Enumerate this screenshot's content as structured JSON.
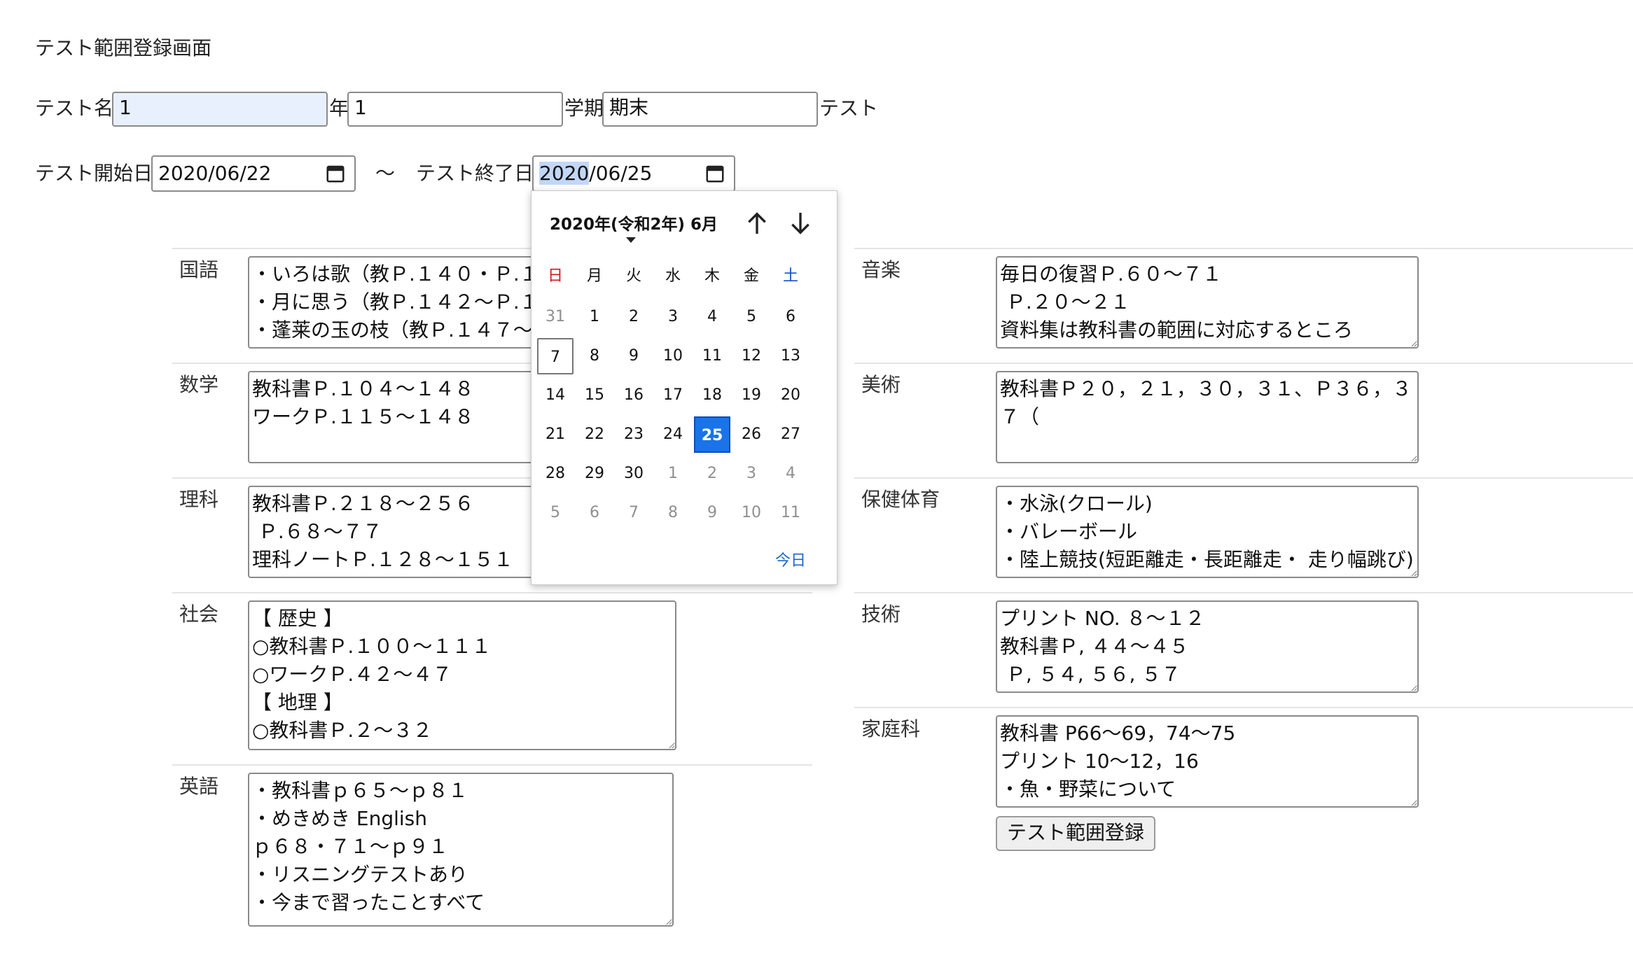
{
  "page_title": "テスト範囲登録画面",
  "row1": {
    "label_test_name": "テスト名",
    "grade_value": "1",
    "label_year": "年",
    "term_value": "1",
    "label_term": "学期",
    "kind_value": "期末",
    "label_test": "テスト"
  },
  "row2": {
    "label_start": "テスト開始日",
    "start_date": "2020/06/22",
    "tilde": "〜",
    "label_end": "テスト終了日",
    "end_date_year": "2020",
    "end_date_rest": "/06/25"
  },
  "calendar": {
    "title": "2020年(令和2年) 6月",
    "weekdays": [
      "日",
      "月",
      "火",
      "水",
      "木",
      "金",
      "土"
    ],
    "weeks": [
      [
        "31",
        "1",
        "2",
        "3",
        "4",
        "5",
        "6"
      ],
      [
        "7",
        "8",
        "9",
        "10",
        "11",
        "12",
        "13"
      ],
      [
        "14",
        "15",
        "16",
        "17",
        "18",
        "19",
        "20"
      ],
      [
        "21",
        "22",
        "23",
        "24",
        "25",
        "26",
        "27"
      ],
      [
        "28",
        "29",
        "30",
        "1",
        "2",
        "3",
        "4"
      ],
      [
        "5",
        "6",
        "7",
        "8",
        "9",
        "10",
        "11"
      ]
    ],
    "selected_day": "25",
    "today_day": "7",
    "today_label": "今日"
  },
  "subjects": {
    "kokugo": {
      "label": "国語",
      "value": "・いろは歌（教Ｐ.１４０・Ｐ.１４\n・月に思う（教Ｐ.１４２〜Ｐ.１４\n・蓬莱の玉の枝（教Ｐ.１４７〜Ｐ"
    },
    "sugaku": {
      "label": "数学",
      "value": "教科書Ｐ.１０４〜１４８\nワークＰ.１１５〜１４８"
    },
    "rika": {
      "label": "理科",
      "value": "教科書Ｐ.２１８〜２５６\n Ｐ.６８〜７７\n理科ノートＰ.１２８〜１５１"
    },
    "shakai": {
      "label": "社会",
      "value": "【 歴史 】\n○教科書Ｐ.１００〜１１１\n○ワークＰ.４２〜４７\n【 地理 】\n○教科書Ｐ.２〜３２"
    },
    "eigo": {
      "label": "英語",
      "value": "・教科書ｐ６５〜ｐ８１\n・めきめき English\nｐ６８・７１〜ｐ９１\n・リスニングテストあり\n・今まで習ったことすべて"
    },
    "ongaku": {
      "label": "音楽",
      "value": "毎日の復習Ｐ.６０〜７１\n Ｐ.２０〜２１\n資料集は教科書の範囲に対応するところ"
    },
    "bijutsu": {
      "label": "美術",
      "value": "教科書Ｐ２０，２１，３０，３１、Ｐ３６，３\n７（"
    },
    "hoken": {
      "label": "保健体育",
      "value": "・水泳(クロール)\n・バレーボール\n・陸上競技(短距離走・長距離走・ 走り幅跳び)"
    },
    "gijutsu": {
      "label": "技術",
      "value": "プリント NO. ８〜１２\n教科書Ｐ, ４４〜４５\n Ｐ, ５４, ５６, ５７"
    },
    "katei": {
      "label": "家庭科",
      "value": "教科書 P66〜69，74〜75\nプリント 10〜12，16\n・魚・野菜について"
    }
  },
  "submit_label": "テスト範囲登録",
  "colors": {
    "selected_day_bg": "#1a73e8",
    "sunday": "#d8141b",
    "saturday": "#1b4fc8",
    "focused_input_bg": "#e8f0fe"
  }
}
